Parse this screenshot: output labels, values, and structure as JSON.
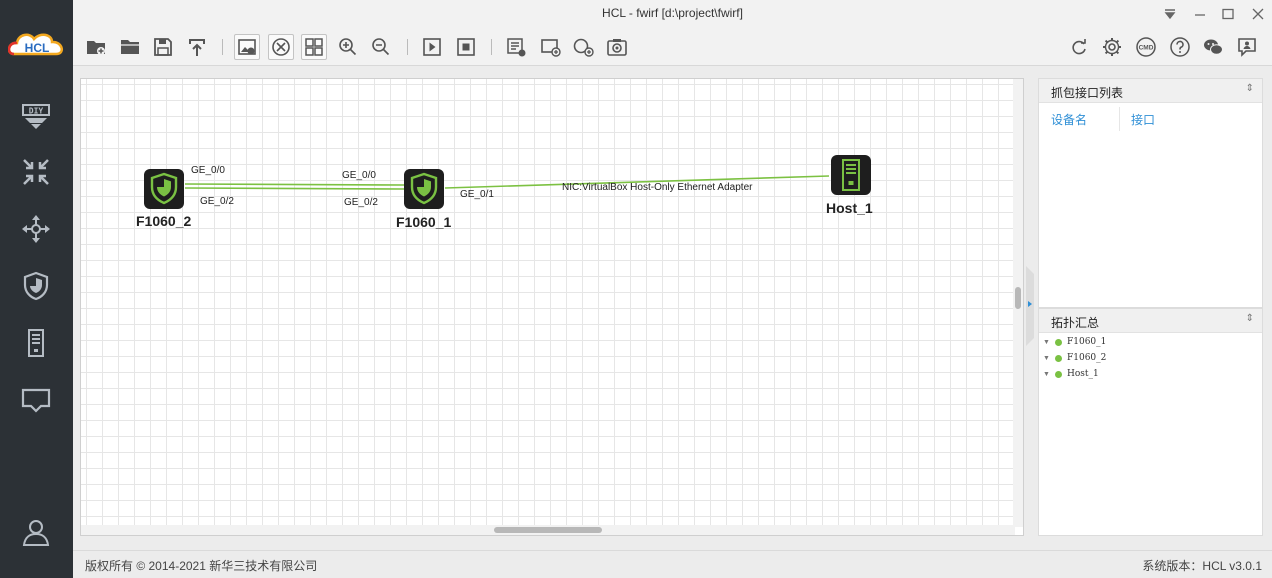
{
  "app": {
    "title": "HCL - fwirf [d:\\project\\fwirf]",
    "logo_text": "HCL"
  },
  "sidebar": {
    "items": [
      {
        "name": "diy-icon"
      },
      {
        "name": "router-icon"
      },
      {
        "name": "switch-icon"
      },
      {
        "name": "firewall-icon"
      },
      {
        "name": "host-icon"
      },
      {
        "name": "terminal-icon"
      },
      {
        "name": "user-icon"
      }
    ]
  },
  "toolbar": {
    "icons": [
      "new-project-icon",
      "open-folder-icon",
      "save-icon",
      "export-icon",
      "image-icon",
      "link-mode-icon",
      "grid-icon",
      "zoom-in-icon",
      "zoom-out-icon",
      "start-icon",
      "stop-icon",
      "list-icon",
      "add-area-icon",
      "add-shape-icon",
      "camera-icon",
      "refresh-icon",
      "settings-icon",
      "cmd-icon",
      "help-icon",
      "wechat-icon",
      "feedback-icon"
    ]
  },
  "topology": {
    "devices": [
      {
        "id": "F1060_2",
        "label": "F1060_2",
        "type": "firewall"
      },
      {
        "id": "F1060_1",
        "label": "F1060_1",
        "type": "firewall"
      },
      {
        "id": "Host_1",
        "label": "Host_1",
        "type": "host"
      }
    ],
    "ports": {
      "f2_ge00": "GE_0/0",
      "f2_ge02": "GE_0/2",
      "f1_ge00": "GE_0/0",
      "f1_ge02": "GE_0/2",
      "f1_ge01": "GE_0/1",
      "host_nic": "NIC:VirtualBox Host-Only Ethernet Adapter"
    },
    "link_color": "#7cc142"
  },
  "capture_panel": {
    "title": "抓包接口列表",
    "col_device": "设备名",
    "col_interface": "接口"
  },
  "topo_panel": {
    "title": "拓扑汇总",
    "items": [
      "F1060_1",
      "F1060_2",
      "Host_1"
    ]
  },
  "footer": {
    "copyright": "版权所有 © 2014-2021 新华三技术有限公司",
    "version": "系统版本：HCL v3.0.1"
  },
  "colors": {
    "sidebar_bg": "#2c3136",
    "accent": "#2f8fd6",
    "device_green": "#7ac143"
  }
}
